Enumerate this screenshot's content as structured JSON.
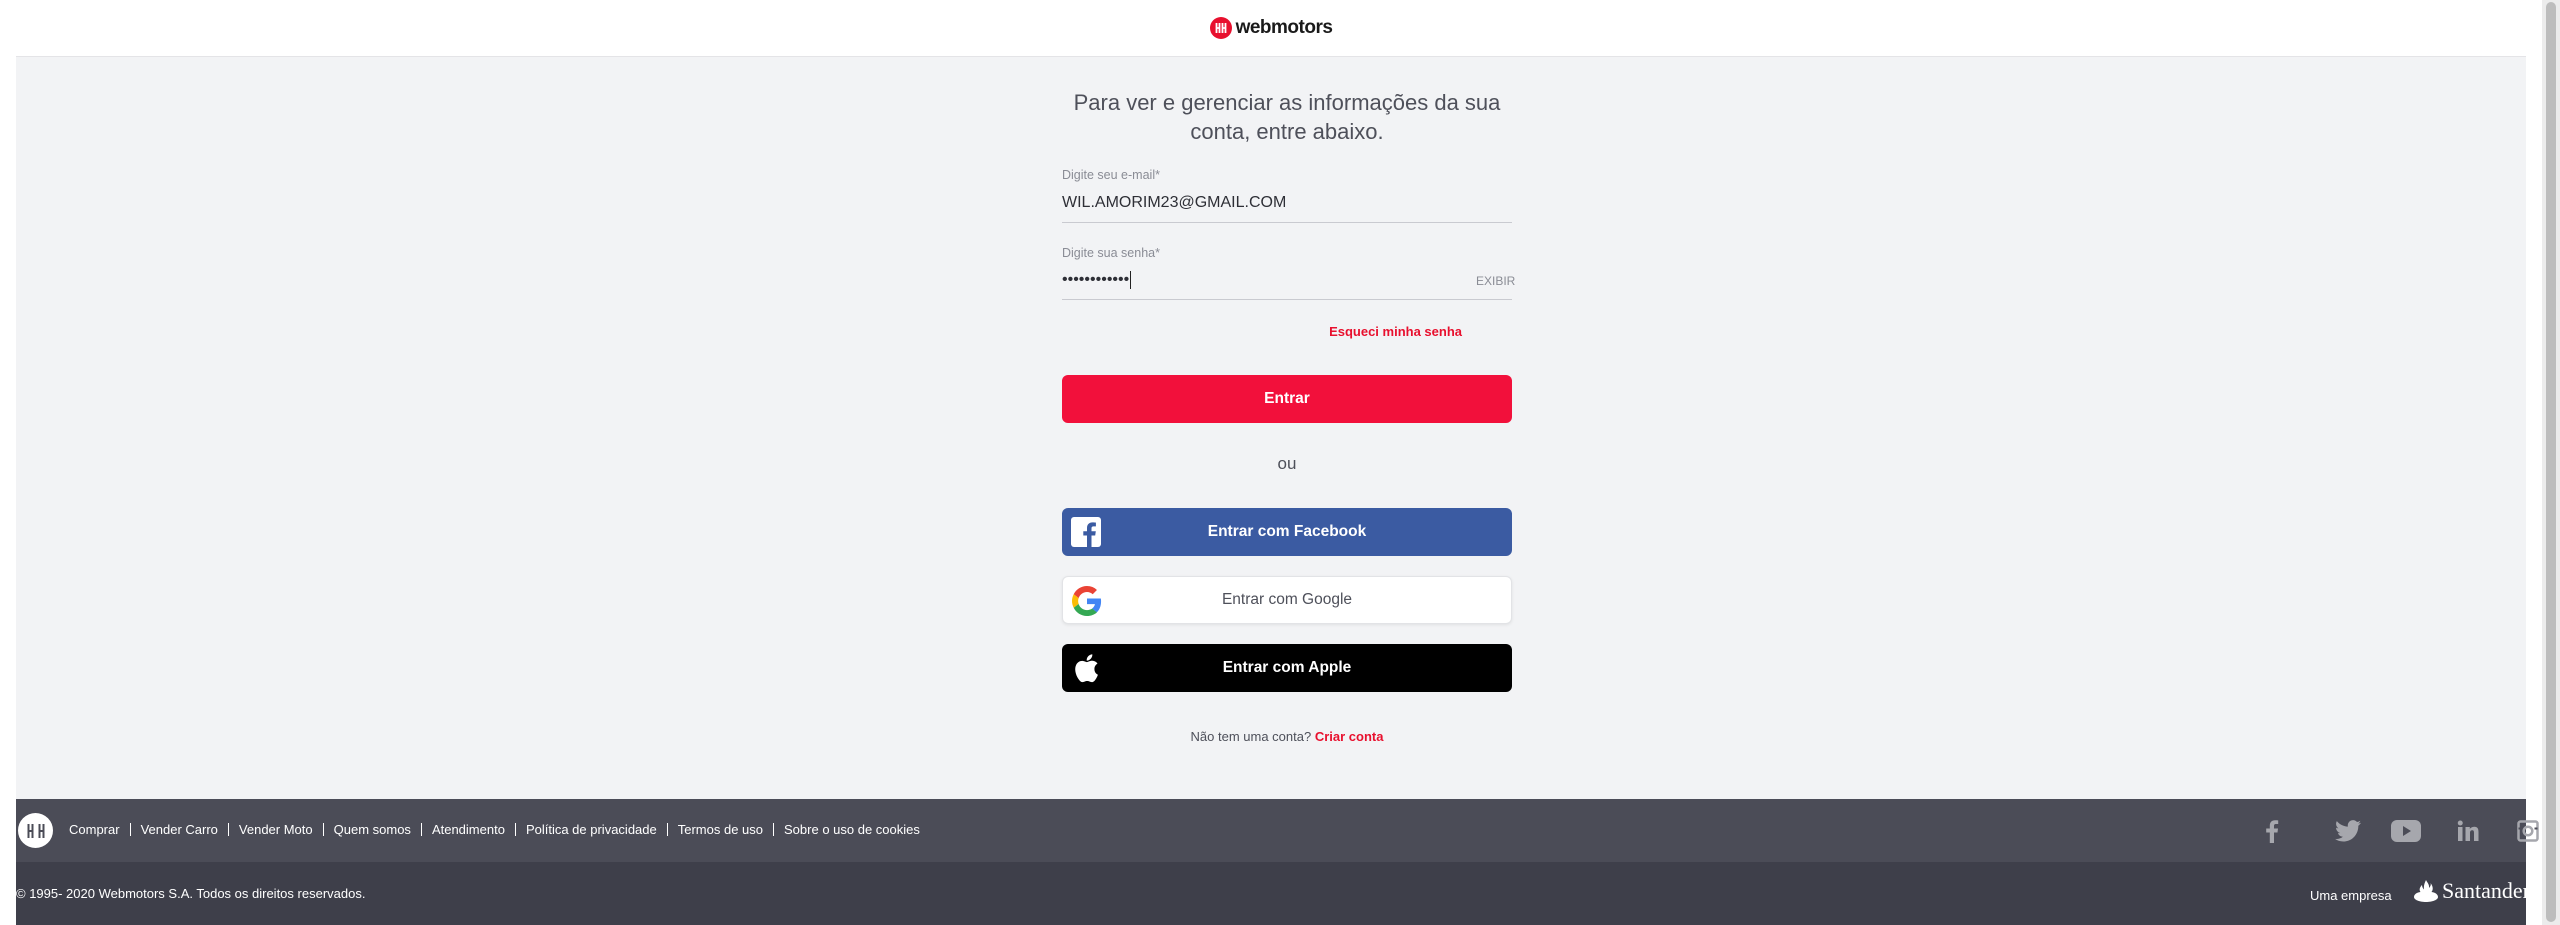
{
  "header": {
    "brand": "webmotors"
  },
  "login": {
    "heading": "Para ver e gerenciar as informações da sua conta, entre abaixo.",
    "email": {
      "label": "Digite seu e-mail*",
      "value": "WIL.AMORIM23@GMAIL.COM"
    },
    "password": {
      "label": "Digite sua senha*",
      "masked_value": "••••••••••••",
      "show_label": "EXIBIR"
    },
    "forgot_password": "Esqueci minha senha",
    "submit_label": "Entrar",
    "divider": "ou",
    "social": {
      "facebook": "Entrar com Facebook",
      "google": "Entrar com Google",
      "apple": "Entrar com Apple"
    },
    "signup": {
      "prompt": "Não tem uma conta?",
      "link": "Criar conta"
    }
  },
  "footer": {
    "links": [
      "Comprar",
      "Vender Carro",
      "Vender Moto",
      "Quem somos",
      "Atendimento",
      "Política de privacidade",
      "Termos de uso",
      "Sobre o uso de cookies"
    ],
    "social_icons": [
      "facebook-icon",
      "twitter-icon",
      "youtube-icon",
      "linkedin-icon",
      "instagram-icon"
    ],
    "copyright": "© 1995- 2020 Webmotors S.A. Todos os direitos reservados.",
    "company_label": "Uma empresa",
    "company_name": "Santander"
  },
  "colors": {
    "brand_red": "#f2103b",
    "facebook_blue": "#3b5ba2",
    "footer_dark": "#4b4c57",
    "footer_darker": "#3e3f4a",
    "page_bg": "#f2f3f5"
  }
}
